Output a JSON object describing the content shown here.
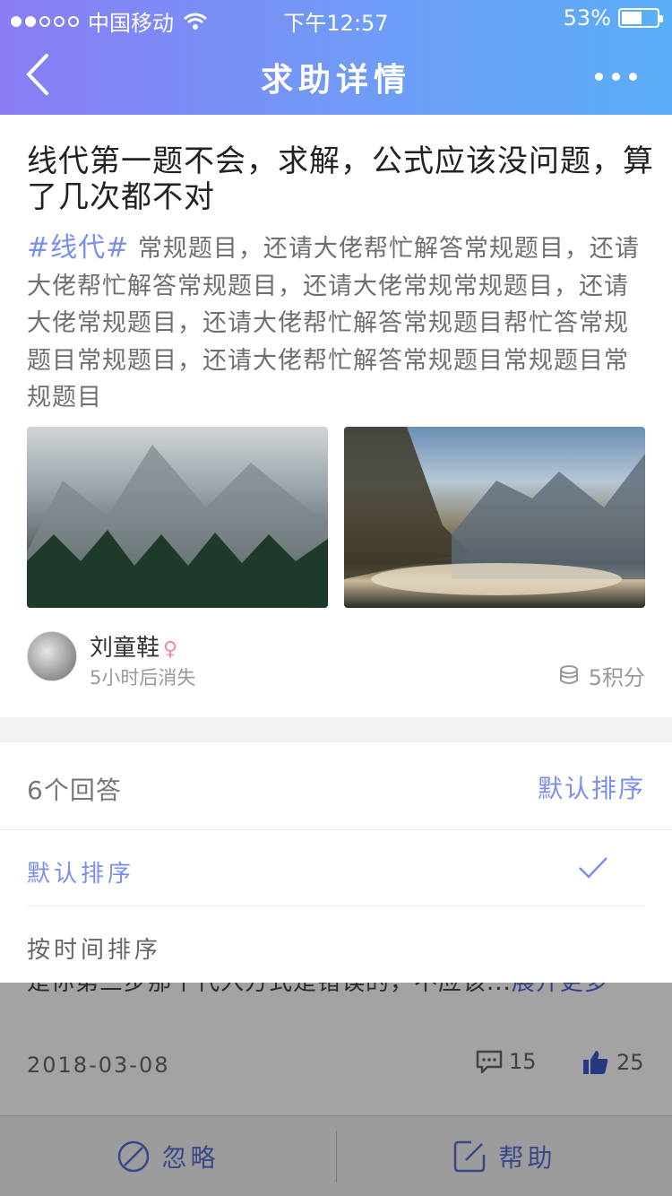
{
  "status_bar": {
    "carrier": "中国移动",
    "time": "下午12:57",
    "battery": "53%"
  },
  "nav": {
    "title": "求助详情"
  },
  "question": {
    "title": "线代第一题不会，求解，公式应该没问题，算了几次都不对",
    "tag": "#线代#",
    "body": " 常规题目，还请大佬帮忙解答常规题目，还请大佬帮忙解答常规题目，还请大佬常规常规题目，还请大佬常规题目，还请大佬帮忙解答常规题目帮忙答常规题目常规题目，还请大佬帮忙解答常规题目常规题目常规题目"
  },
  "author": {
    "name": "刘童鞋",
    "gender_symbol": "♀",
    "expire": "5小时后消失",
    "points": "5积分"
  },
  "answers": {
    "count_label": "6个回答",
    "sort_label": "默认排序"
  },
  "sort_options": [
    {
      "label": "默认排序",
      "selected": true
    },
    {
      "label": "按时间排序",
      "selected": false
    }
  ],
  "answer_preview": {
    "text": "是你第三步那个代入方式是错误的，不应该...",
    "expand": "展开更多",
    "date": "2018-03-08",
    "comments": "15",
    "likes": "25"
  },
  "bottom": {
    "ignore": "忽略",
    "help": "帮助"
  },
  "colors": {
    "accent": "#7b8ef0",
    "header_start": "#8a7cf5",
    "header_end": "#5aaef8"
  }
}
